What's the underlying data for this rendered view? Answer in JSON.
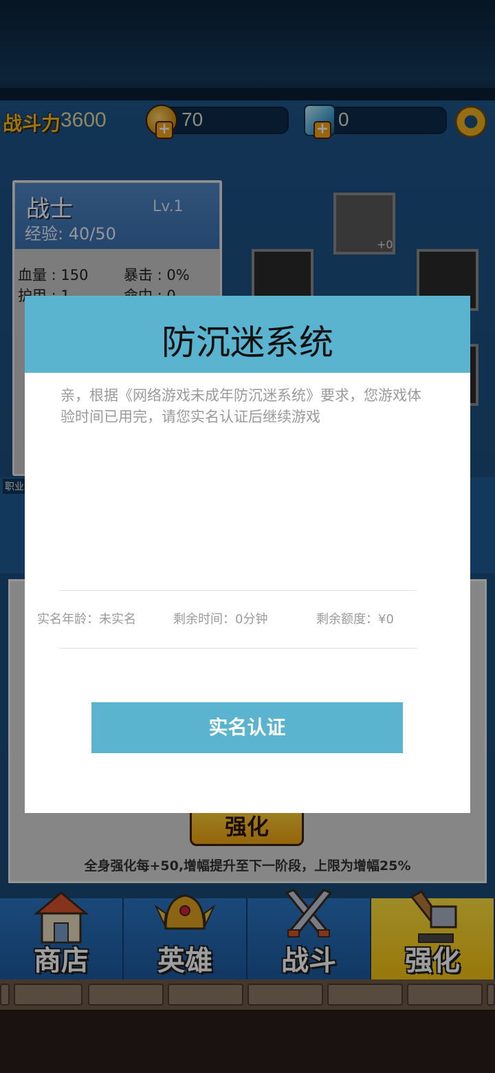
{
  "status_bar": {
    "power_label": "战斗力",
    "power_value": "3600",
    "gold": "70",
    "gems": "0",
    "gold_plus": "+",
    "gem_plus": "+"
  },
  "hero": {
    "name": "战士",
    "level": "Lv.1",
    "exp": "经验: 40/50",
    "stats": [
      {
        "label": "血量 : 150"
      },
      {
        "label": "暴击 : 0%"
      },
      {
        "label": "护甲 : 1"
      },
      {
        "label": "命中 : 0"
      }
    ],
    "slot_bonus": "+0",
    "job_label": "职业"
  },
  "enhance": {
    "button_label": "强化",
    "hint": "全身强化每+50,增幅提升至下一阶段，上限为增幅25%"
  },
  "bottom_nav": [
    {
      "label": "商店",
      "icon": "shop-icon"
    },
    {
      "label": "英雄",
      "icon": "helmet-icon"
    },
    {
      "label": "战斗",
      "icon": "crossed-swords-icon"
    },
    {
      "label": "强化",
      "icon": "hammer-icon"
    }
  ],
  "dialog": {
    "title": "防沉迷系统",
    "message": "亲，根据《网络游戏未成年防沉迷系统》要求，您游戏体验时间已用完，请您实名认证后继续游戏",
    "age_label": "实名年龄：未实名",
    "time_label": "剩余时间：0分钟",
    "quota_label": "剩余额度：¥0",
    "verify_button": "实名认证"
  },
  "colors": {
    "dialog_accent": "#5ab4cf",
    "game_blue": "#1d5489",
    "gold": "#f4c020"
  }
}
